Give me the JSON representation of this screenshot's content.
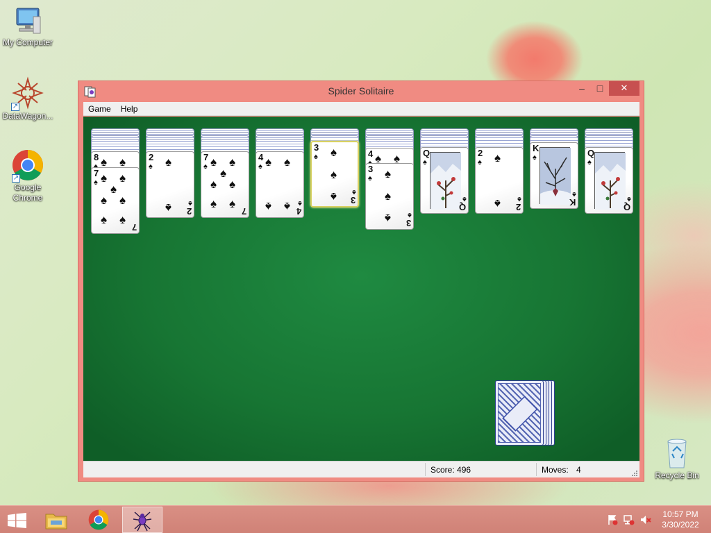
{
  "desktop": {
    "icons": [
      {
        "label": "My Computer"
      },
      {
        "label": "DataWagon..."
      },
      {
        "label": "Google Chrome"
      },
      {
        "label": "Recycle Bin"
      }
    ]
  },
  "window": {
    "title": "Spider Solitaire",
    "controls": {
      "minimize": "–",
      "maximize": "□",
      "close": "✕"
    },
    "menu": [
      "Game",
      "Help"
    ]
  },
  "status": {
    "score": "Score: 496",
    "moves_label": "Moves:",
    "moves_value": "4"
  },
  "tableau": [
    {
      "cards": [
        {
          "rank": "8",
          "suit": "♠"
        },
        {
          "rank": "7",
          "suit": "♠"
        }
      ]
    },
    {
      "cards": [
        {
          "rank": "2",
          "suit": "♠"
        }
      ]
    },
    {
      "cards": [
        {
          "rank": "7",
          "suit": "♠"
        }
      ]
    },
    {
      "cards": [
        {
          "rank": "4",
          "suit": "♠"
        }
      ]
    },
    {
      "cards": [
        {
          "rank": "3",
          "suit": "♠",
          "selected": true
        }
      ]
    },
    {
      "cards": [
        {
          "rank": "4",
          "suit": "♠"
        },
        {
          "rank": "3",
          "suit": "♠"
        }
      ]
    },
    {
      "cards": [
        {
          "rank": "Q",
          "suit": "♠"
        }
      ]
    },
    {
      "cards": [
        {
          "rank": "2",
          "suit": "♠"
        }
      ]
    },
    {
      "cards": [
        {
          "rank": "K",
          "suit": "♠"
        }
      ]
    },
    {
      "cards": [
        {
          "rank": "Q",
          "suit": "♠"
        }
      ]
    }
  ],
  "taskbar": {
    "clock_time": "10:57 PM",
    "clock_date": "3/30/2022"
  },
  "colors": {
    "window_frame": "#f08b82",
    "felt": "#177533",
    "taskbar": "#d08277"
  }
}
